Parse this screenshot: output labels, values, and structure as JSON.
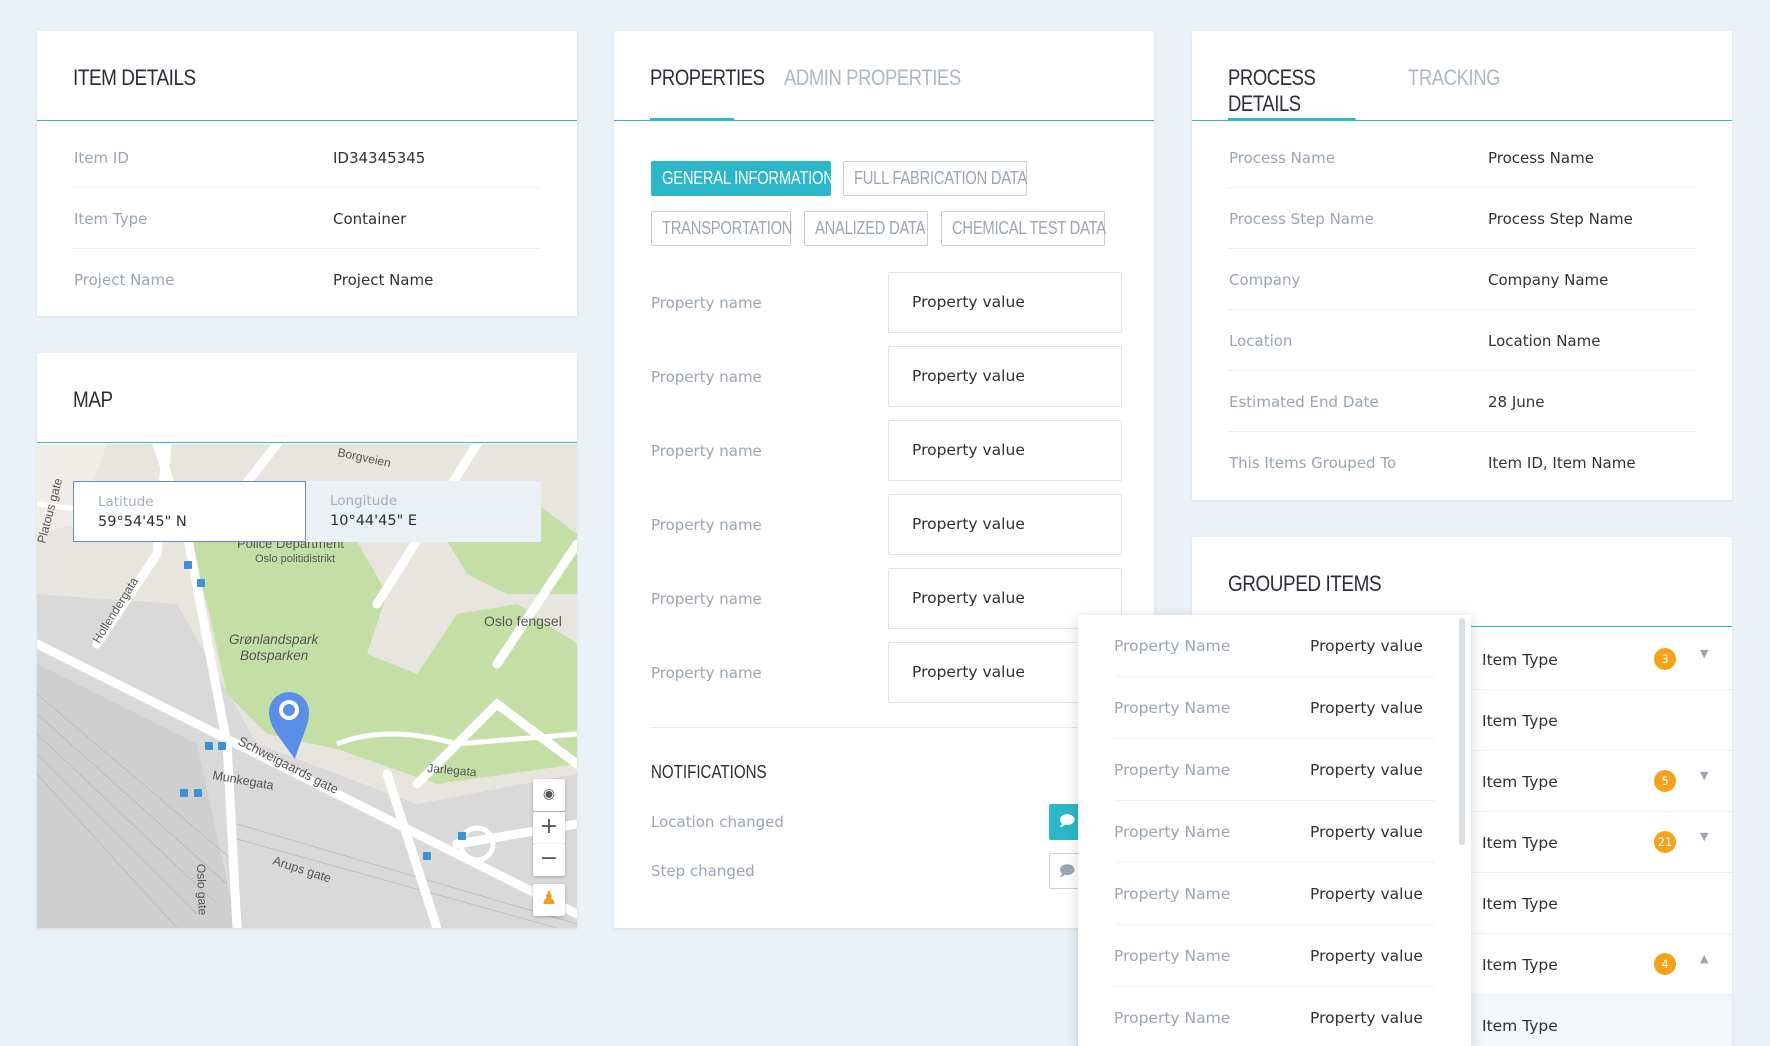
{
  "item_details": {
    "title": "Item Details",
    "rows": [
      {
        "label": "Item ID",
        "value": "ID34345345"
      },
      {
        "label": "Item Type",
        "value": "Container"
      },
      {
        "label": "Project Name",
        "value": "Project Name"
      }
    ]
  },
  "map": {
    "title": "MAP",
    "latitude_label": "Latitude",
    "latitude_value": "59°54'45\" N",
    "longitude_label": "Longitude",
    "longitude_value": "10°44'45\" E",
    "labels": {
      "police": "Police Department",
      "police_sub": "Oslo politidistrikt",
      "park1": "Grønlandspark",
      "park2": "Botsparken",
      "prison": "Oslo fengsel",
      "street1": "Schweigaards gate",
      "street2": "Munkegata",
      "street3": "Jarlegata",
      "street4": "Arups gate",
      "street5": "Hollendergata",
      "street6": "Platous gate",
      "street7": "Oslo gate",
      "street8": "Borgveien"
    },
    "zoom_in": "+",
    "zoom_out": "−"
  },
  "properties": {
    "tabs": [
      "Properties",
      "Admin Properties"
    ],
    "chips": [
      "General Information",
      "Full Fabrication Data",
      "Transportation",
      "Analized Data",
      "Chemical Test Data"
    ],
    "rows": [
      {
        "name": "Property name",
        "value": "Property value"
      },
      {
        "name": "Property name",
        "value": "Property value"
      },
      {
        "name": "Property name",
        "value": "Property value"
      },
      {
        "name": "Property name",
        "value": "Property value"
      },
      {
        "name": "Property name",
        "value": "Property value"
      },
      {
        "name": "Property name",
        "value": "Property value"
      }
    ],
    "notifications_title": "Notifications",
    "notifications": [
      {
        "label": "Location changed",
        "active": true
      },
      {
        "label": "Step changed",
        "active": false
      }
    ]
  },
  "process": {
    "tabs": [
      "Process Details",
      "Tracking"
    ],
    "rows": [
      {
        "label": "Process Name",
        "value": "Process Name"
      },
      {
        "label": "Process Step Name",
        "value": "Process Step Name"
      },
      {
        "label": "Company",
        "value": "Company Name"
      },
      {
        "label": "Location",
        "value": "Location Name"
      },
      {
        "label": "Estimated End Date",
        "value": "28 June"
      },
      {
        "label": "This Items Grouped To",
        "value": "Item ID, Item Name"
      }
    ]
  },
  "grouped": {
    "title": "Grouped Items",
    "rows": [
      {
        "label": "Item Type",
        "badge": "3",
        "caret": "down"
      },
      {
        "label": "Item Type",
        "badge": "",
        "caret": ""
      },
      {
        "label": "Item Type",
        "badge": "5",
        "caret": "down"
      },
      {
        "label": "Item Type",
        "badge": "21",
        "caret": "down"
      },
      {
        "label": "Item Type",
        "badge": "",
        "caret": ""
      },
      {
        "label": "Item Type",
        "badge": "4",
        "caret": "up"
      },
      {
        "label": "Item Type",
        "badge": "",
        "caret": ""
      }
    ]
  },
  "popup": {
    "rows": [
      {
        "name": "Property Name",
        "value": "Property value"
      },
      {
        "name": "Property Name",
        "value": "Property value"
      },
      {
        "name": "Property Name",
        "value": "Property value"
      },
      {
        "name": "Property Name",
        "value": "Property value"
      },
      {
        "name": "Property Name",
        "value": "Property value"
      },
      {
        "name": "Property Name",
        "value": "Property value"
      },
      {
        "name": "Property Name",
        "value": "Property value"
      }
    ]
  },
  "colors": {
    "accent": "#2cb7c9",
    "badge": "#f5a21b",
    "background": "#ebf1f7"
  }
}
